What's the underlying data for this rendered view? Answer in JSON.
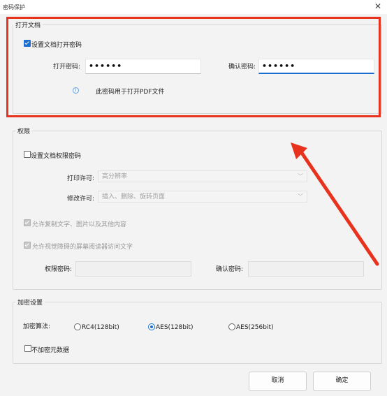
{
  "window": {
    "title": "密码保护",
    "close_glyph": "✕"
  },
  "open_doc": {
    "legend": "打开文档",
    "set_password_label": "设置文档打开密码",
    "set_password_checked": true,
    "open_password_label": "打开密码:",
    "open_password_value": "••••••",
    "confirm_password_label": "确认密码:",
    "confirm_password_value": "••••••",
    "info_glyph": "i",
    "info_text": "此密码用于打开PDF文件"
  },
  "permissions": {
    "legend": "权限",
    "set_password_label": "设置文档权限密码",
    "set_password_checked": false,
    "print_label": "打印许可:",
    "print_value": "高分辨率",
    "modify_label": "修改许可:",
    "modify_value": "插入、删除、旋转页面",
    "allow_copy_label": "允许复制文字、图片以及其他内容",
    "allow_reader_label": "允许视觉障碍的屏幕阅读器访问文字",
    "perm_password_label": "权限密码:",
    "perm_confirm_label": "确认密码:",
    "chevron": "﹀"
  },
  "encryption": {
    "legend": "加密设置",
    "algorithm_label": "加密算法:",
    "options": [
      "RC4(128bit)",
      "AES(128bit)",
      "AES(256bit)"
    ],
    "selected": "AES(128bit)",
    "no_metadata_label": "不加密元数据",
    "no_metadata_checked": false
  },
  "buttons": {
    "cancel": "取消",
    "ok": "确定"
  },
  "colors": {
    "highlight": "#e8321e",
    "accent": "#1a6fd1"
  }
}
